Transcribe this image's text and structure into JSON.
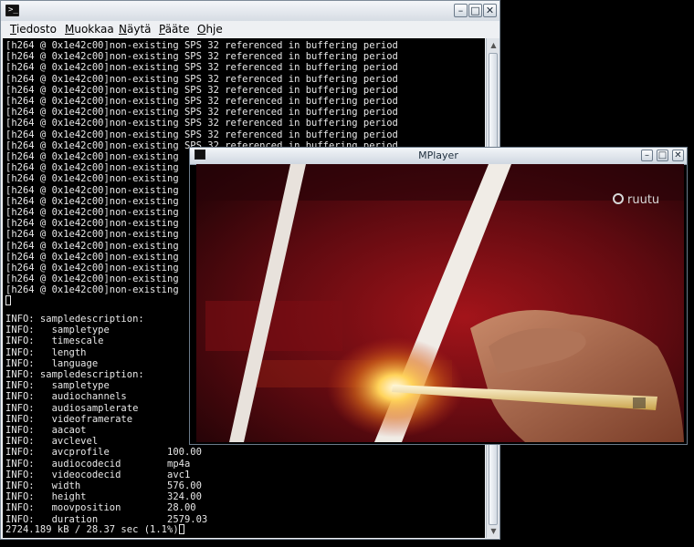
{
  "terminal": {
    "menu": [
      "Tiedosto",
      "Muokkaa",
      "Näytä",
      "Pääte",
      "Ohje"
    ],
    "menu_mnemonics": [
      "T",
      "M",
      "N",
      "P",
      "O"
    ],
    "output_top": "[h264 @ 0x1e42c00]non-existing SPS 32 referenced in buffering period\n[h264 @ 0x1e42c00]non-existing SPS 32 referenced in buffering period\n[h264 @ 0x1e42c00]non-existing SPS 32 referenced in buffering period\n[h264 @ 0x1e42c00]non-existing SPS 32 referenced in buffering period\n[h264 @ 0x1e42c00]non-existing SPS 32 referenced in buffering period\n[h264 @ 0x1e42c00]non-existing SPS 32 referenced in buffering period\n[h264 @ 0x1e42c00]non-existing SPS 32 referenced in buffering period\n[h264 @ 0x1e42c00]non-existing SPS 32 referenced in buffering period\n[h264 @ 0x1e42c00]non-existing SPS 32 referenced in buffering period\n[h264 @ 0x1e42c00]non-existing SPS 32 referenced in buffering period\n[h264 @ 0x1e42c00]non-existing\n[h264 @ 0x1e42c00]non-existing\n[h264 @ 0x1e42c00]non-existing\n[h264 @ 0x1e42c00]non-existing\n[h264 @ 0x1e42c00]non-existing\n[h264 @ 0x1e42c00]non-existing\n[h264 @ 0x1e42c00]non-existing\n[h264 @ 0x1e42c00]non-existing\n[h264 @ 0x1e42c00]non-existing\n[h264 @ 0x1e42c00]non-existing\n[h264 @ 0x1e42c00]non-existing\n[h264 @ 0x1e42c00]non-existing\n[h264 @ 0x1e42c00]non-existing",
    "output_info": "INFO: sampledescription:\nINFO:   sampletype\nINFO:   timescale\nINFO:   length\nINFO:   language\nINFO: sampledescription:\nINFO:   sampletype\nINFO:   audiochannels\nINFO:   audiosamplerate\nINFO:   videoframerate\nINFO:   aacaot\nINFO:   avclevel\nINFO:   avcprofile          100.00\nINFO:   audiocodecid        mp4a\nINFO:   videocodecid        avc1\nINFO:   width               576.00\nINFO:   height              324.00\nINFO:   moovposition        28.00\nINFO:   duration            2579.03",
    "status_line": "2724.189 kB / 28.37 sec (1.1%)"
  },
  "mplayer": {
    "title": "MPlayer",
    "watermark": "ruutu"
  }
}
